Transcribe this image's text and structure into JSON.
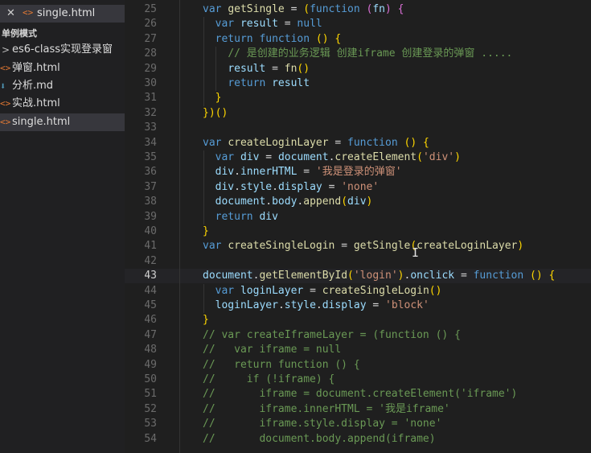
{
  "sidebar": {
    "open_editor": {
      "close_glyph": "✕",
      "icon": "html-file-icon",
      "icon_glyph": "<>",
      "label": "single.html"
    },
    "section_title": "单例模式",
    "items": [
      {
        "label": "es6-class实现登录窗",
        "type": "folder",
        "chevron": ">"
      },
      {
        "label": "弹窗.html",
        "type": "html",
        "glyph": "<>"
      },
      {
        "label": "分析.md",
        "type": "md",
        "glyph": "⬇"
      },
      {
        "label": "实战.html",
        "type": "html",
        "glyph": "<>"
      },
      {
        "label": "single.html",
        "type": "html",
        "glyph": "<>",
        "selected": true
      }
    ]
  },
  "editor": {
    "current_line": 43,
    "lines": [
      {
        "n": "25",
        "code": "var getSingle = (function (fn) {"
      },
      {
        "n": "26",
        "code": "  var result = null"
      },
      {
        "n": "27",
        "code": "  return function () {"
      },
      {
        "n": "28",
        "code": "    // 是创建的业务逻辑 创建iframe 创建登录的弹窗 ....."
      },
      {
        "n": "29",
        "code": "    result = fn()"
      },
      {
        "n": "30",
        "code": "    return result"
      },
      {
        "n": "31",
        "code": "  }"
      },
      {
        "n": "32",
        "code": "})()"
      },
      {
        "n": "33",
        "code": ""
      },
      {
        "n": "34",
        "code": "var createLoginLayer = function () {"
      },
      {
        "n": "35",
        "code": "  var div = document.createElement('div')"
      },
      {
        "n": "36",
        "code": "  div.innerHTML = '我是登录的弹窗'"
      },
      {
        "n": "37",
        "code": "  div.style.display = 'none'"
      },
      {
        "n": "38",
        "code": "  document.body.append(div)"
      },
      {
        "n": "39",
        "code": "  return div"
      },
      {
        "n": "40",
        "code": "}"
      },
      {
        "n": "41",
        "code": "var createSingleLogin = getSingle(createLoginLayer)"
      },
      {
        "n": "42",
        "code": ""
      },
      {
        "n": "43",
        "code": "document.getElementById('login').onclick = function () {"
      },
      {
        "n": "44",
        "code": "  var loginLayer = createSingleLogin()"
      },
      {
        "n": "45",
        "code": "  loginLayer.style.display = 'block'"
      },
      {
        "n": "46",
        "code": "}"
      },
      {
        "n": "47",
        "code": "// var createIframeLayer = (function () {"
      },
      {
        "n": "48",
        "code": "//   var iframe = null"
      },
      {
        "n": "49",
        "code": "//   return function () {"
      },
      {
        "n": "50",
        "code": "//     if (!iframe) {"
      },
      {
        "n": "51",
        "code": "//       iframe = document.createElement('iframe')"
      },
      {
        "n": "52",
        "code": "//       iframe.innerHTML = '我是iframe'"
      },
      {
        "n": "53",
        "code": "//       iframe.style.display = 'none'"
      },
      {
        "n": "54",
        "code": "//       document.body.append(iframe)"
      }
    ]
  },
  "colors": {
    "keyword": "#569cd6",
    "function": "#dcdcaa",
    "variable": "#9cdcfe",
    "string": "#ce9178",
    "comment": "#6a9955",
    "html_icon": "#e37933",
    "md_icon": "#519aba"
  }
}
